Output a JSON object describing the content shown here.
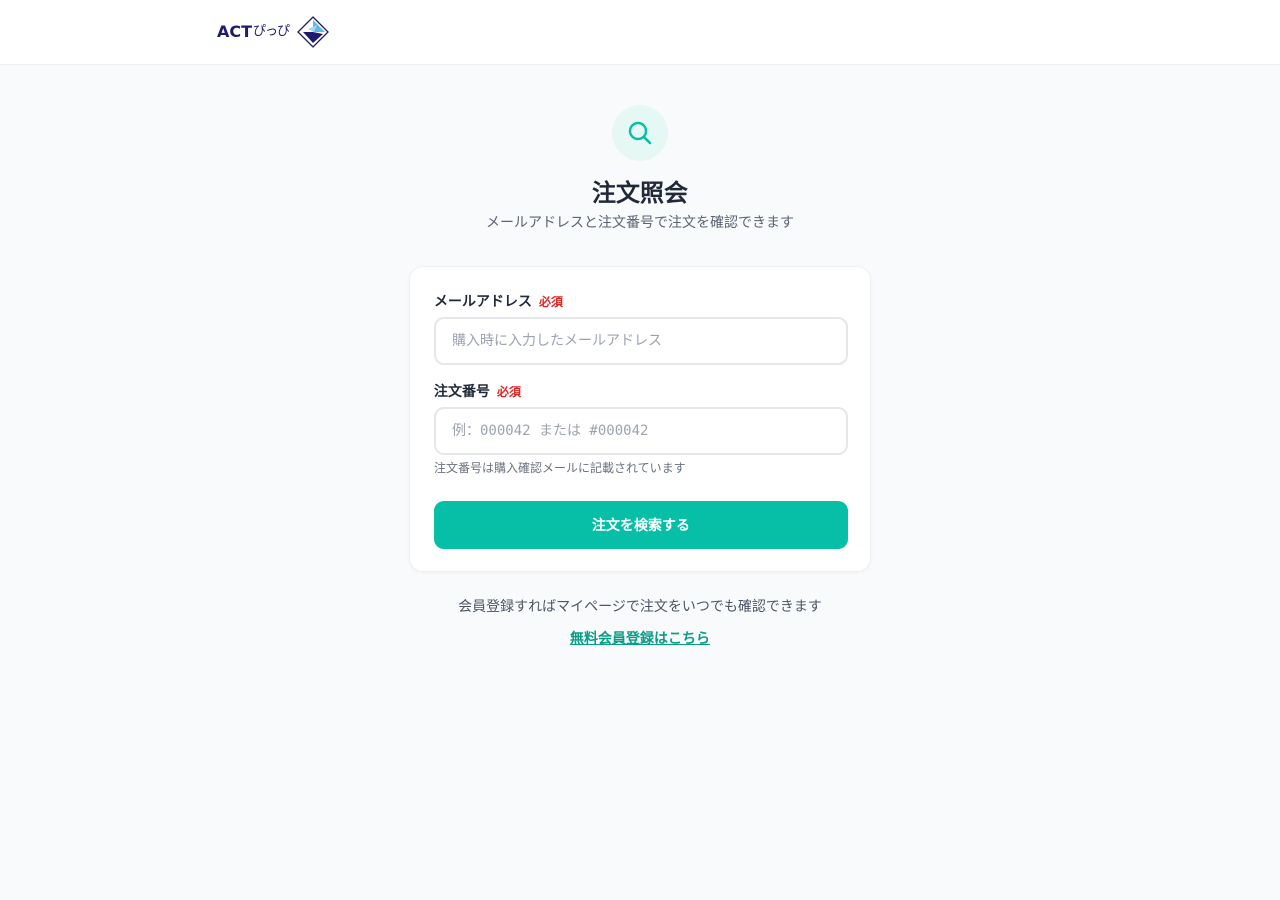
{
  "header": {
    "logo_text": "ACT",
    "logo_kana": "ぴっぴ",
    "logo_mark_icon": "paper-plane-mark"
  },
  "hero": {
    "icon": "search-icon",
    "title": "注文照会",
    "subtitle": "メールアドレスと注文番号で注文を確認できます"
  },
  "form": {
    "email": {
      "label": "メールアドレス",
      "required": "必須",
      "placeholder": "購入時に入力したメールアドレス",
      "value": ""
    },
    "order_number": {
      "label": "注文番号",
      "required": "必須",
      "placeholder": "例：000042 または #000042",
      "value": ""
    },
    "help_text": "注文番号は購入確認メールに記載されています",
    "submit_label": "注文を検索する"
  },
  "footer": {
    "note": "会員登録すればマイページで注文をいつでも確認できます",
    "register_link": "無料会員登録はこちら"
  },
  "colors": {
    "accent": "#06bfa6",
    "link": "#0a9d86",
    "required": "#dc2626",
    "brand_navy": "#1e1b6e"
  }
}
